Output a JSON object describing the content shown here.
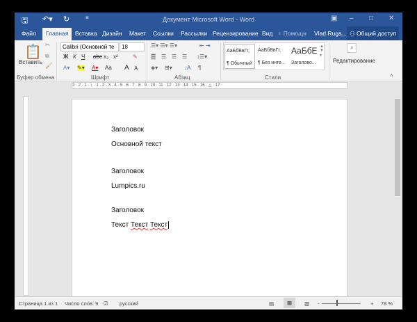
{
  "title": "Документ Microsoft Word - Word",
  "quick_access": {
    "save_icon": "save-icon",
    "undo_icon": "undo-icon",
    "redo_icon": "redo-icon",
    "customize_icon": "customize-icon"
  },
  "window_controls": [
    "ribbon-options-icon",
    "minimize-icon",
    "maximize-icon",
    "close-icon"
  ],
  "tabs": [
    "Файл",
    "Главная",
    "Вставка",
    "Дизайн",
    "Макет",
    "Ссылки",
    "Рассылки",
    "Рецензирование",
    "Вид"
  ],
  "active_tab": "Главная",
  "tell_me": "Помощн",
  "user": "Vlad Ruga...",
  "share": "Общий доступ",
  "ribbon": {
    "clipboard": {
      "paste": "Вставить",
      "label": "Буфер обмена"
    },
    "font": {
      "name": "Calibri (Основной те",
      "size": "18",
      "bold": "Ж",
      "italic": "К",
      "underline": "Ч",
      "strike": "abc",
      "sub": "x₂",
      "sup": "x²",
      "case": "Aa",
      "grow": "A",
      "shrink": "A",
      "label": "Шрифт"
    },
    "paragraph": {
      "label": "Абзац",
      "pilcrow": "¶"
    },
    "styles": {
      "items": [
        {
          "sample": "АаБбВвГг,",
          "name": "¶ Обычный"
        },
        {
          "sample": "АаБбВвГг,",
          "name": "¶ Без инте..."
        },
        {
          "sample": "АаБбЕ",
          "name": "Заголово..."
        }
      ],
      "label": "Стили"
    },
    "editing": {
      "label": "Редактирование"
    }
  },
  "ruler": "3 · 2 · 1 · ↕ · 1 · 2 · 3 · 4 · 5 · 6 · 7 · 8 · 9 · 10 · 11 · 12 · 13 · 14 · 15 · 16 · △ · 17 ·",
  "document": {
    "paragraphs": [
      "Заголовок",
      "Основной текст",
      "Заголовок",
      "Lumpics.ru",
      "Заголовок"
    ],
    "last_line": [
      "Текст ",
      "Текст",
      " ",
      "Текст"
    ]
  },
  "status": {
    "page": "Страница 1 из 1",
    "words": "Число слов: 9",
    "language": "русский",
    "zoom": "78 %",
    "zoom_percent": 78
  }
}
